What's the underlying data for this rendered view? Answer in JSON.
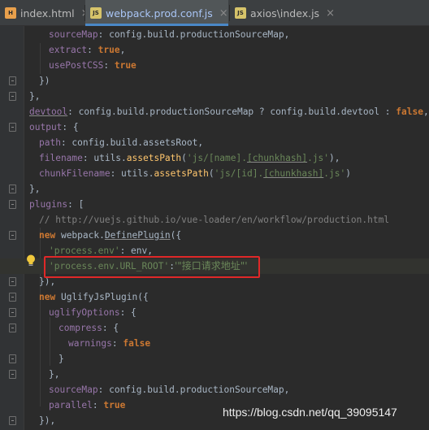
{
  "tabs": [
    {
      "label": "index.html",
      "icon": "html-file-icon",
      "active": false
    },
    {
      "label": "webpack.prod.conf.js",
      "icon": "js-file-icon",
      "active": true
    },
    {
      "label": "axios\\index.js",
      "icon": "js-file-icon",
      "active": false
    }
  ],
  "tab_close": "×",
  "colors": {
    "background": "#2b2b2b",
    "keyword": "#cc7832",
    "string": "#6a8759",
    "comment": "#808080",
    "function": "#ffc66d",
    "highlight_box": "#e02828"
  },
  "code": {
    "l1": {
      "a": "sourceMap",
      "b": ": config.build.productionSourceMap,"
    },
    "l2": {
      "a": "extract",
      "b": ": ",
      "c": "true",
      "d": ","
    },
    "l3": {
      "a": "usePostCSS",
      "b": ": ",
      "c": "true"
    },
    "l4": {
      "a": "})"
    },
    "l5": {
      "a": "},"
    },
    "l6": {
      "a": "devtool",
      "b": ": config.build.productionSourceMap ? config.build.devtool : ",
      "c": "false",
      "d": ","
    },
    "l7": {
      "a": "output",
      "b": ": {"
    },
    "l8": {
      "a": "path",
      "b": ": config.build.assetsRoot,"
    },
    "l9": {
      "a": "filename",
      "b": ": utils.",
      "c": "assetsPath",
      "d": "(",
      "e": "'js/[name].",
      "f": "[chunkhash]",
      "g": ".js'",
      "h": "),"
    },
    "l10": {
      "a": "chunkFilename",
      "b": ": utils.",
      "c": "assetsPath",
      "d": "(",
      "e": "'js/[id].",
      "f": "[chunkhash]",
      "g": ".js'",
      "h": ")"
    },
    "l11": {
      "a": "},"
    },
    "l12": {
      "a": "plugins",
      "b": ": ["
    },
    "l13": {
      "a": "// http://vuejs.github.io/vue-loader/en/workflow/production.html"
    },
    "l14": {
      "a": "new ",
      "b": "webpack.",
      "c": "DefinePlugin",
      "d": "({"
    },
    "l15": {
      "a": "'process.env'",
      "b": ": env,"
    },
    "l16": {
      "a": "'process.env.URL_ROOT'",
      "b": ":",
      "c": "'\"接口请求地址\"'"
    },
    "l17": {
      "a": "}),"
    },
    "l18": {
      "a": "new ",
      "b": "UglifyJsPlugin",
      "c": "({"
    },
    "l19": {
      "a": "uglifyOptions",
      "b": ": {"
    },
    "l20": {
      "a": "compress",
      "b": ": {"
    },
    "l21": {
      "a": "warnings",
      "b": ": ",
      "c": "false"
    },
    "l22": {
      "a": "}"
    },
    "l23": {
      "a": "},"
    },
    "l24": {
      "a": "sourceMap",
      "b": ": config.build.productionSourceMap,"
    },
    "l25": {
      "a": "parallel",
      "b": ": ",
      "c": "true"
    },
    "l26": {
      "a": "}),"
    }
  },
  "watermark": "https://blog.csdn.net/qq_39095147"
}
